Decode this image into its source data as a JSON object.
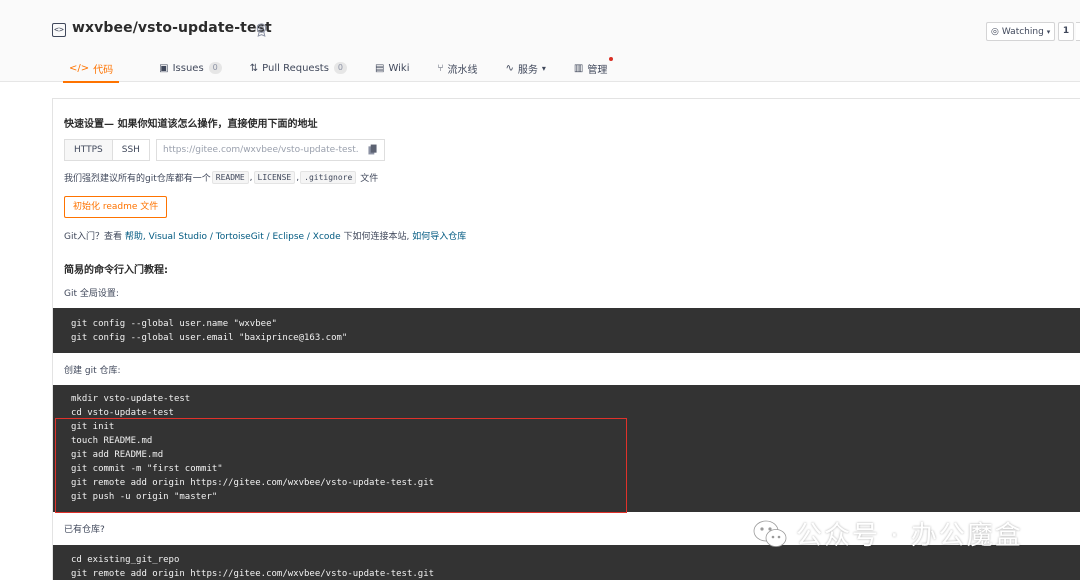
{
  "repo": {
    "title": "wxvbee/vsto-update-test",
    "watch_label": "Watching",
    "watch_count": "1"
  },
  "tabs": [
    {
      "label": "代码",
      "icon": "code-icon",
      "active": true
    },
    {
      "label": "Issues",
      "icon": "issues-icon",
      "count": "0"
    },
    {
      "label": "Pull Requests",
      "icon": "pull-request-icon",
      "count": "0"
    },
    {
      "label": "Wiki",
      "icon": "wiki-icon"
    },
    {
      "label": "流水线",
      "icon": "pipeline-icon"
    },
    {
      "label": "服务",
      "icon": "service-icon",
      "dropdown": true
    },
    {
      "label": "管理",
      "icon": "manage-icon",
      "dot": true
    }
  ],
  "quick_setup": {
    "title": "快速设置— 如果你知道该怎么操作，直接使用下面的地址",
    "https_label": "HTTPS",
    "ssh_label": "SSH",
    "url": "https://gitee.com/wxvbee/vsto-update-test.",
    "recommend_prefix": "我们强烈建议所有的git仓库都有一个",
    "chips": [
      "README",
      "LICENSE",
      ".gitignore"
    ],
    "recommend_suffix": "文件",
    "init_button": "初始化 readme 文件"
  },
  "git_intro": {
    "prefix": "Git入门？查看",
    "help": "帮助",
    "tools": ", Visual Studio / TortoiseGit / Eclipse / Xcode",
    "middle": "下如何连接本站,",
    "import": "如何导入仓库"
  },
  "tutorial": {
    "title": "简易的命令行入门教程:",
    "global_label": "Git 全局设置:",
    "global_code": "git config --global user.name \"wxvbee\"\ngit config --global user.email \"baxiprince@163.com\"",
    "create_label": "创建 git 仓库:",
    "create_code": "mkdir vsto-update-test\ncd vsto-update-test\ngit init\ntouch README.md\ngit add README.md\ngit commit -m \"first commit\"\ngit remote add origin https://gitee.com/wxvbee/vsto-update-test.git\ngit push -u origin \"master\"",
    "existing_label": "已有仓库?",
    "existing_code": "cd existing_git_repo\ngit remote add origin https://gitee.com/wxvbee/vsto-update-test.git"
  },
  "watermark": "公众号 · 办公魔盒",
  "colors": {
    "accent": "#fe7300",
    "highlight_box": "#e0322b",
    "code_bg": "#333333",
    "link": "#005980"
  }
}
